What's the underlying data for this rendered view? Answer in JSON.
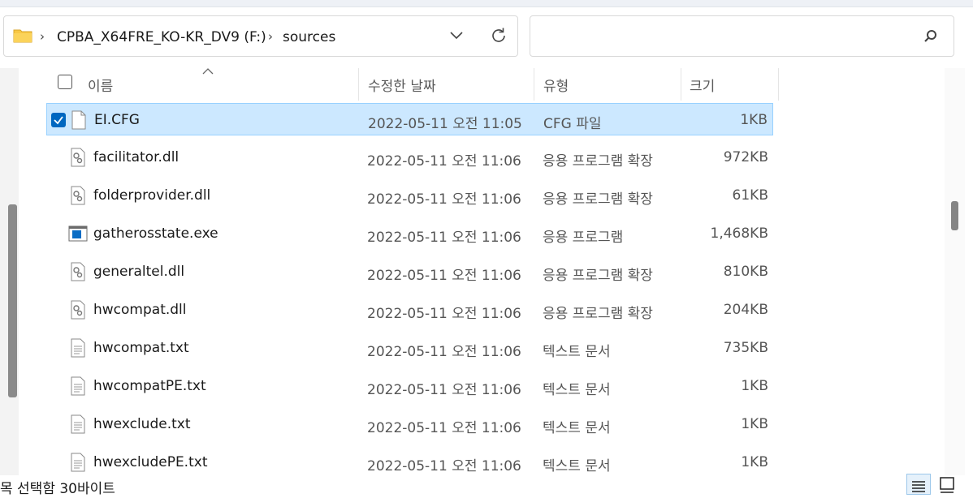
{
  "address_bar": {
    "crumbs": [
      "CPBA_X64FRE_KO-KR_DV9 (F:)",
      "sources"
    ]
  },
  "search": {
    "placeholder": ""
  },
  "columns": {
    "name": "이름",
    "date": "수정한 날짜",
    "type": "유형",
    "size": "크기"
  },
  "files": [
    {
      "name": "EI.CFG",
      "date": "2022-05-11 오전 11:05",
      "type": "CFG 파일",
      "size": "1KB",
      "icon": "generic-file-icon",
      "selected": true
    },
    {
      "name": "facilitator.dll",
      "date": "2022-05-11 오전 11:06",
      "type": "응용 프로그램 확장",
      "size": "972KB",
      "icon": "dll-file-icon",
      "selected": false
    },
    {
      "name": "folderprovider.dll",
      "date": "2022-05-11 오전 11:06",
      "type": "응용 프로그램 확장",
      "size": "61KB",
      "icon": "dll-file-icon",
      "selected": false
    },
    {
      "name": "gatherosstate.exe",
      "date": "2022-05-11 오전 11:06",
      "type": "응용 프로그램",
      "size": "1,468KB",
      "icon": "exe-file-icon",
      "selected": false
    },
    {
      "name": "generaltel.dll",
      "date": "2022-05-11 오전 11:06",
      "type": "응용 프로그램 확장",
      "size": "810KB",
      "icon": "dll-file-icon",
      "selected": false
    },
    {
      "name": "hwcompat.dll",
      "date": "2022-05-11 오전 11:06",
      "type": "응용 프로그램 확장",
      "size": "204KB",
      "icon": "dll-file-icon",
      "selected": false
    },
    {
      "name": "hwcompat.txt",
      "date": "2022-05-11 오전 11:06",
      "type": "텍스트 문서",
      "size": "735KB",
      "icon": "text-file-icon",
      "selected": false
    },
    {
      "name": "hwcompatPE.txt",
      "date": "2022-05-11 오전 11:06",
      "type": "텍스트 문서",
      "size": "1KB",
      "icon": "text-file-icon",
      "selected": false
    },
    {
      "name": "hwexclude.txt",
      "date": "2022-05-11 오전 11:06",
      "type": "텍스트 문서",
      "size": "1KB",
      "icon": "text-file-icon",
      "selected": false
    },
    {
      "name": "hwexcludePE.txt",
      "date": "2022-05-11 오전 11:06",
      "type": "텍스트 문서",
      "size": "1KB",
      "icon": "text-file-icon",
      "selected": false
    }
  ],
  "status": {
    "text": "목 선택함 30바이트"
  },
  "colors": {
    "selection": "#cce8ff",
    "selection_border": "#99d1ff",
    "accent": "#0067c0",
    "folder": "#f8c845"
  }
}
